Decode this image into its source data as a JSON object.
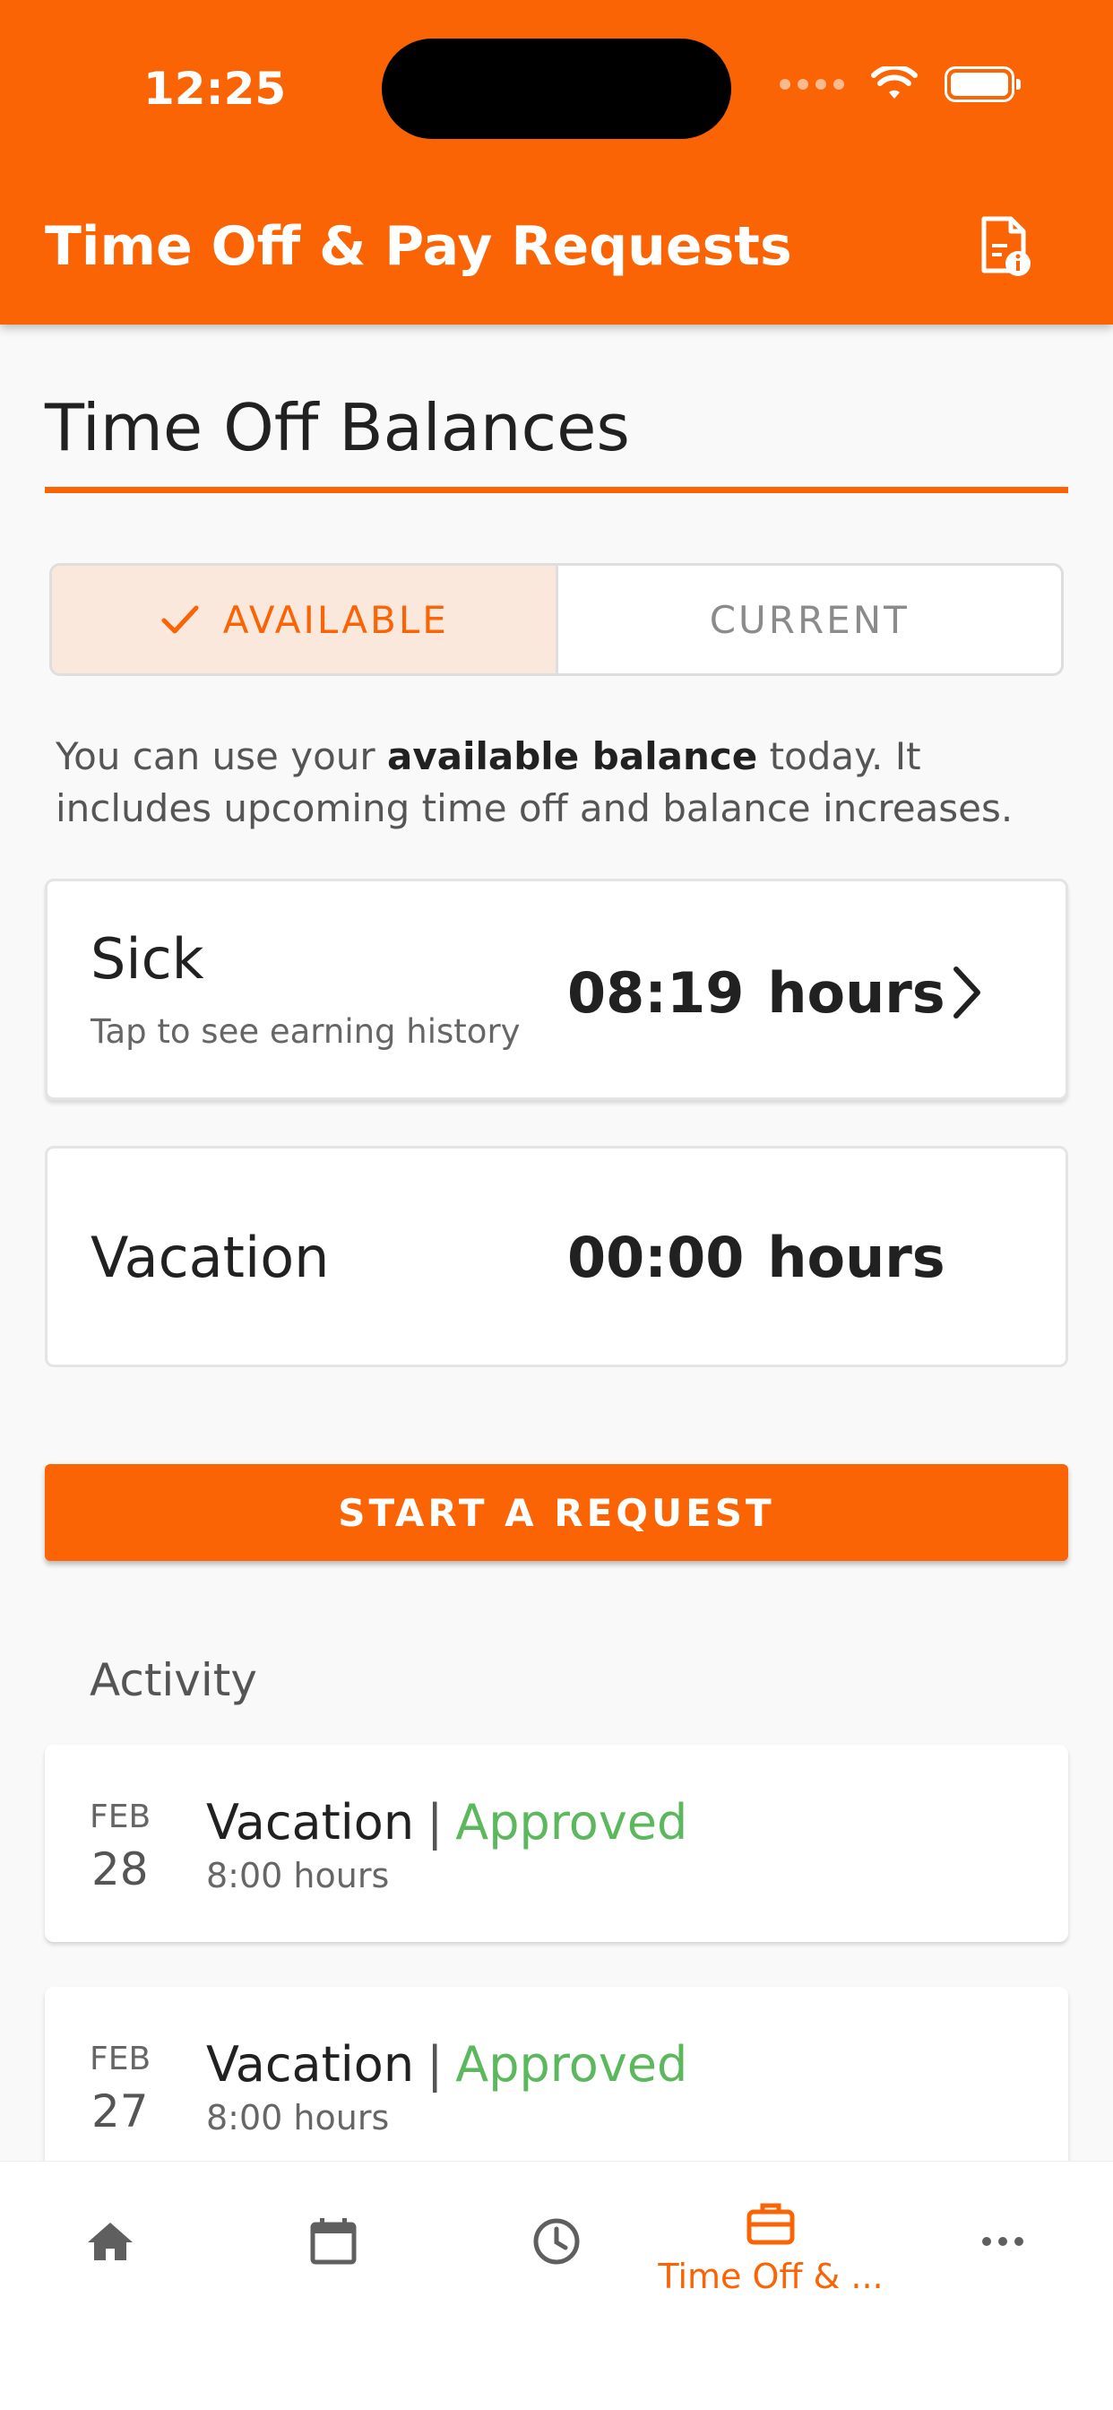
{
  "status_bar": {
    "time": "12:25"
  },
  "header": {
    "title": "Time Off & Pay Requests",
    "action_icon": "document-info-icon"
  },
  "balances": {
    "title": "Time Off Balances",
    "tabs": [
      {
        "label": "AVAILABLE",
        "active": true
      },
      {
        "label": "CURRENT",
        "active": false
      }
    ],
    "info_prefix": "You can use your ",
    "info_bold": "available balance",
    "info_suffix": " today. It includes upcoming time off and balance increases.",
    "items": [
      {
        "name": "Sick",
        "hint": "Tap to see earning history",
        "value": "08:19",
        "unit": "hours"
      },
      {
        "name": "Vacation",
        "value": "00:00",
        "unit": "hours"
      }
    ]
  },
  "start_request_label": "START A REQUEST",
  "activity": {
    "title": "Activity",
    "items": [
      {
        "month": "FEB",
        "day": "28",
        "type": "Vacation",
        "separator": "|",
        "status": "Approved",
        "hours": "8:00 hours"
      },
      {
        "month": "FEB",
        "day": "27",
        "type": "Vacation",
        "separator": "|",
        "status": "Approved",
        "hours": "8:00 hours"
      }
    ]
  },
  "bottom_nav": {
    "items": [
      {
        "icon": "home-icon"
      },
      {
        "icon": "calendar-icon"
      },
      {
        "icon": "clock-icon"
      },
      {
        "icon": "briefcase-icon",
        "label": "Time Off & ...",
        "active": true
      },
      {
        "icon": "more-icon"
      }
    ]
  },
  "colors": {
    "accent": "#fa6405",
    "approved": "#5cb85c",
    "tab_active_bg": "#fbe8dd"
  }
}
